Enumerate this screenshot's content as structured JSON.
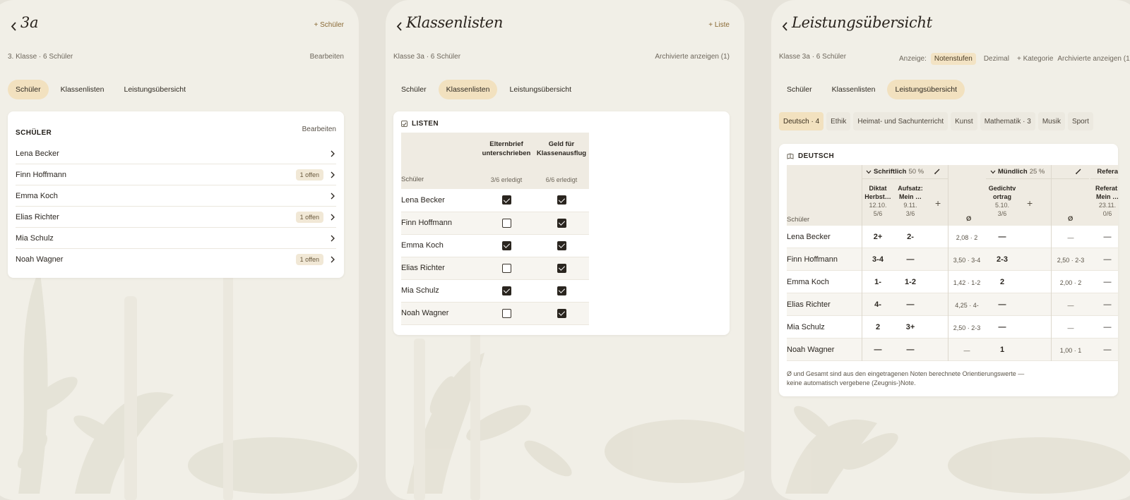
{
  "panels": {
    "students": {
      "title": "3a",
      "action": "+ Schüler",
      "subtitle": "3. Klasse · 6 Schüler",
      "edit": "Bearbeiten",
      "tabs": [
        "Schüler",
        "Klassenlisten",
        "Leistungsübersicht"
      ],
      "active_tab": 0,
      "card_title": "SCHÜLER",
      "card_edit": "Bearbeiten",
      "students": [
        {
          "name": "Lena Becker",
          "badge": ""
        },
        {
          "name": "Finn Hoffmann",
          "badge": "1 offen"
        },
        {
          "name": "Emma Koch",
          "badge": ""
        },
        {
          "name": "Elias Richter",
          "badge": "1 offen"
        },
        {
          "name": "Mia Schulz",
          "badge": ""
        },
        {
          "name": "Noah Wagner",
          "badge": "1 offen"
        }
      ]
    },
    "lists": {
      "title": "Klassenlisten",
      "action": "+ Liste",
      "subtitle": "Klasse 3a · 6 Schüler",
      "archived": "Archivierte anzeigen (1)",
      "tabs": [
        "Schüler",
        "Klassenlisten",
        "Leistungsübersicht"
      ],
      "active_tab": 1,
      "card_title": "LISTEN",
      "name_header": "Schüler",
      "columns": [
        {
          "title_l1": "Elternbrief",
          "title_l2": "unterschrieben",
          "status": "3/6 erledigt"
        },
        {
          "title_l1": "Geld für",
          "title_l2": "Klassenausflug",
          "status": "6/6 erledigt"
        }
      ],
      "rows": [
        {
          "name": "Lena Becker",
          "checks": [
            true,
            true
          ]
        },
        {
          "name": "Finn Hoffmann",
          "checks": [
            false,
            true
          ]
        },
        {
          "name": "Emma Koch",
          "checks": [
            true,
            true
          ]
        },
        {
          "name": "Elias Richter",
          "checks": [
            false,
            true
          ]
        },
        {
          "name": "Mia Schulz",
          "checks": [
            true,
            true
          ]
        },
        {
          "name": "Noah Wagner",
          "checks": [
            false,
            true
          ]
        }
      ]
    },
    "grades": {
      "title": "Leistungsübersicht",
      "subtitle": "Klasse 3a · 6 Schüler",
      "display_label": "Anzeige:",
      "display_options": [
        "Notenstufen",
        "Dezimal"
      ],
      "display_active": 0,
      "add_category": "+ Kategorie",
      "archived": "Archivierte anzeigen (1)",
      "tabs": [
        "Schüler",
        "Klassenlisten",
        "Leistungsübersicht"
      ],
      "active_tab": 2,
      "subjects": [
        "Deutsch · 4",
        "Ethik",
        "Heimat- und Sachunterricht",
        "Kunst",
        "Mathematik · 3",
        "Musik",
        "Sport"
      ],
      "active_subject": 0,
      "card_title": "DEUTSCH",
      "name_header": "Schüler",
      "groups": [
        {
          "name": "Schriftlich",
          "pct": "50 %"
        },
        {
          "name": "Mündlich",
          "pct": "25 %"
        },
        {
          "name": "Refera",
          "pct": ""
        }
      ],
      "cols": [
        {
          "t1": "Diktat",
          "t2": "Herbst…",
          "date": "12.10.",
          "count": "5/6"
        },
        {
          "t1": "Aufsatz:",
          "t2": "Mein …",
          "date": "9.11.",
          "count": "3/6"
        },
        {
          "t1": "Gedichtv",
          "t2": "ortrag",
          "date": "5.10.",
          "count": "3/6"
        },
        {
          "t1": "Referat:",
          "t2": "Mein …",
          "date": "23.11.",
          "count": "0/6"
        }
      ],
      "avg_symbol": "Ø",
      "plus": "+",
      "rows": [
        {
          "name": "Lena Becker",
          "diktat": "2+",
          "aufsatz": "2-",
          "avg1": "2,08 · 2",
          "gedicht": "—",
          "avg2": "—",
          "referat": "—"
        },
        {
          "name": "Finn Hoffmann",
          "diktat": "3-4",
          "aufsatz": "—",
          "avg1": "3,50 · 3-4",
          "gedicht": "2-3",
          "avg2": "2,50 · 2-3",
          "referat": "—"
        },
        {
          "name": "Emma Koch",
          "diktat": "1-",
          "aufsatz": "1-2",
          "avg1": "1,42 · 1-2",
          "gedicht": "2",
          "avg2": "2,00 · 2",
          "referat": "—"
        },
        {
          "name": "Elias Richter",
          "diktat": "4-",
          "aufsatz": "—",
          "avg1": "4,25 · 4-",
          "gedicht": "—",
          "avg2": "—",
          "referat": "—"
        },
        {
          "name": "Mia Schulz",
          "diktat": "2",
          "aufsatz": "3+",
          "avg1": "2,50 · 2-3",
          "gedicht": "—",
          "avg2": "—",
          "referat": "—"
        },
        {
          "name": "Noah Wagner",
          "diktat": "—",
          "aufsatz": "—",
          "avg1": "—",
          "gedicht": "1",
          "avg2": "1,00 · 1",
          "referat": "—"
        }
      ],
      "footnote_l1": "Ø und Gesamt sind aus den eingetragenen Noten berechnete Orientierungswerte —",
      "footnote_l2": "keine automatisch vergebene (Zeugnis-)Note."
    }
  },
  "icons": {
    "back": "chevron-left-icon",
    "chevron": "chevron-right-icon",
    "checkbox": "checkbox-icon",
    "pencil": "pencil-icon",
    "book": "book-icon"
  },
  "colors": {
    "accent": "#8a6a35",
    "chip_active": "#f2e1bf",
    "panel_bg": "#f1efe7"
  }
}
